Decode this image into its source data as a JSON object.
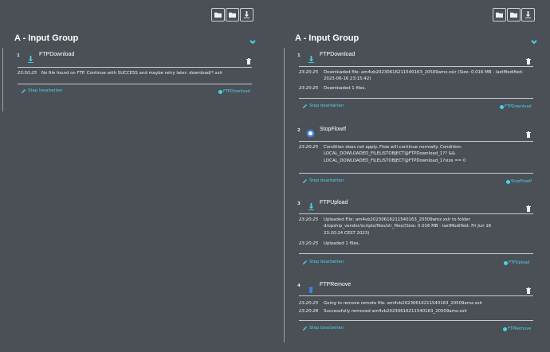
{
  "icons": {
    "folder_add": "folder-plus-icon",
    "folder_open": "folder-icon",
    "download": "download-icon",
    "chevron": "chevron-down-icon",
    "trash": "trash-icon",
    "edit": "edit-icon",
    "step_download": "download-arrow-icon",
    "step_upload": "upload-arrow-icon",
    "step_stopflow": "stop-circle-icon",
    "step_remove": "trash-icon"
  },
  "colors": {
    "accent": "#49d3e6",
    "background": "#4a5056",
    "text": "#ffffff"
  },
  "left": {
    "group_title": "A - Input Group",
    "steps": [
      {
        "number": "1",
        "title": "FTPDownload",
        "logs": [
          {
            "time": "23:50:25",
            "msg": "No file found on FTP. Continue with SUCCESS and maybe retry later: download/*.xslr"
          }
        ],
        "edit": "Step bearbeiten",
        "tag": "FTPDownload"
      }
    ]
  },
  "right": {
    "group_title": "A - Input Group",
    "steps": [
      {
        "number": "1",
        "title": "FTPDownload",
        "logs": [
          {
            "time": "23:20:25",
            "msg": "Downloaded file: am4vb20230616211540163_20509amz.xslr (Size: 0.016 MB - lastModified: 2023-06-16 23:15:42)"
          },
          {
            "time": "23:20:25",
            "msg": "Downloaded 1 files."
          }
        ],
        "edit": "Step bearbeiten",
        "tag": "FTPDownload"
      },
      {
        "number": "2",
        "title": "StopFlowIf",
        "logs": [
          {
            "time": "23:20:25",
            "msg": "Condition does not apply. Flow will continue normally. Condition: LOCAL_DOWLOADED_FILELISTOBJECT@FTPDownload_1?? && LOCAL_DOWLOADED_FILELISTOBJECT@FTPDownload_1?size == 0"
          }
        ],
        "edit": "Step bearbeiten",
        "tag": "StopFlowIf"
      },
      {
        "number": "3",
        "title": "FTPUpload",
        "logs": [
          {
            "time": "23:20:25",
            "msg": "Uploaded File: am4vb20230616211540163_20509amz.xslr to folder dropship_vendor/scripts/files/slr_files/(Size: 0.016 MB - lastModified: Fri Jun 16 23:20:24 CEST 2023)"
          },
          {
            "time": "23:20:25",
            "msg": "Uploaded 1 files."
          }
        ],
        "edit": "Step bearbeiten",
        "tag": "FTPUpload"
      },
      {
        "number": "4",
        "title": "FTPRemove",
        "logs": [
          {
            "time": "23:20:25",
            "msg": "Going to remove remote file: am4vb20230616211540163_20509amz.xslr"
          },
          {
            "time": "23:20:28",
            "msg": "Successfully removed am4vb20230616211540163_20509amz.xslr"
          }
        ],
        "edit": "Step bearbeiten",
        "tag": "FTPRemove"
      }
    ]
  }
}
